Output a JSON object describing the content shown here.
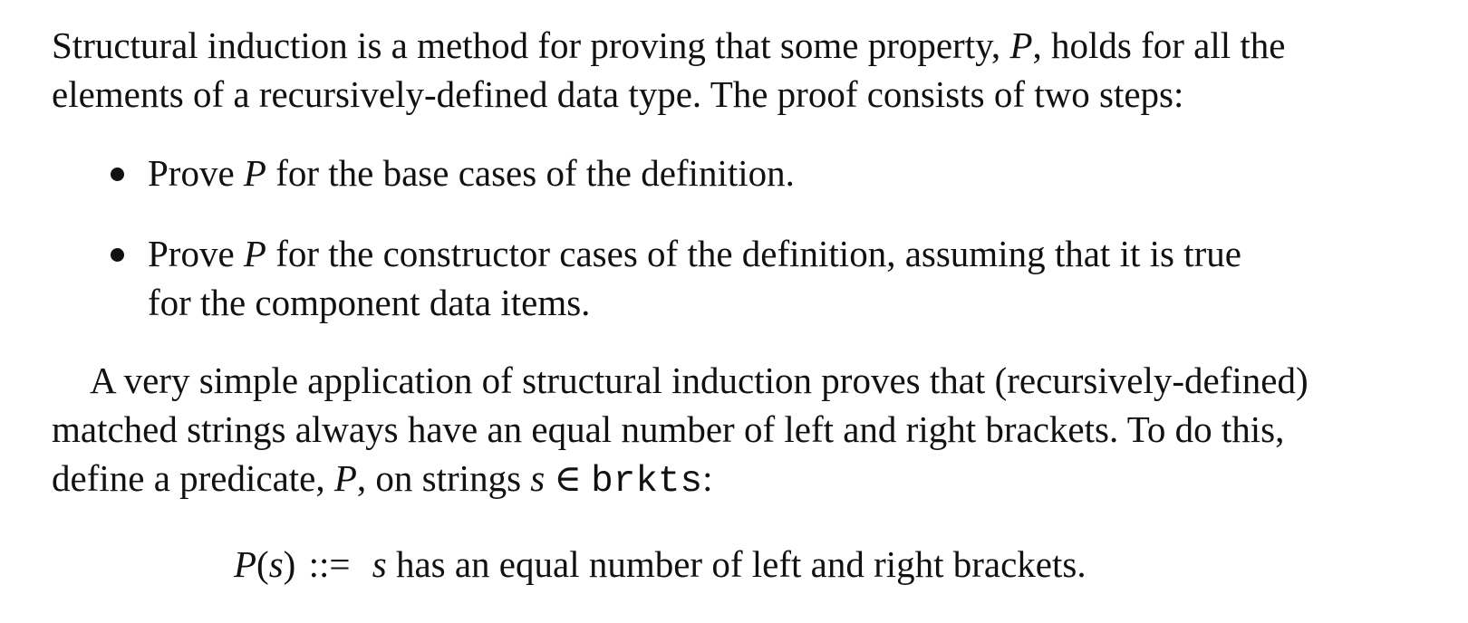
{
  "para1": {
    "line1_a": "Structural induction is a method for proving that some property, ",
    "line1_var": "P",
    "line1_b": ", holds for all the",
    "line2": "elements of a recursively-defined data type. The proof consists of two steps:"
  },
  "bullets": [
    {
      "a": "Prove ",
      "var": "P",
      "b": " for the base cases of the definition."
    },
    {
      "a": "Prove ",
      "var": "P",
      "b": " for the constructor cases of the definition, assuming that it is true",
      "cont": "for the component data items."
    }
  ],
  "para2": {
    "line1": "A very simple application of structural induction proves that (recursively-defined)",
    "line2": "matched strings always have an equal number of left and right brackets. To do this,",
    "line3_a": "define a predicate, ",
    "line3_var": "P",
    "line3_b": ", on strings ",
    "line3_s": "s",
    "line3_in": " ∈ ",
    "line3_set": "brkts",
    "line3_colon": ":"
  },
  "definition": {
    "lhs_var": "P",
    "lhs_open": "(",
    "lhs_arg": "s",
    "lhs_close": ")",
    "op": " ::= ",
    "rhs_var": "s",
    "rhs_text": " has an equal number of left and right brackets."
  }
}
